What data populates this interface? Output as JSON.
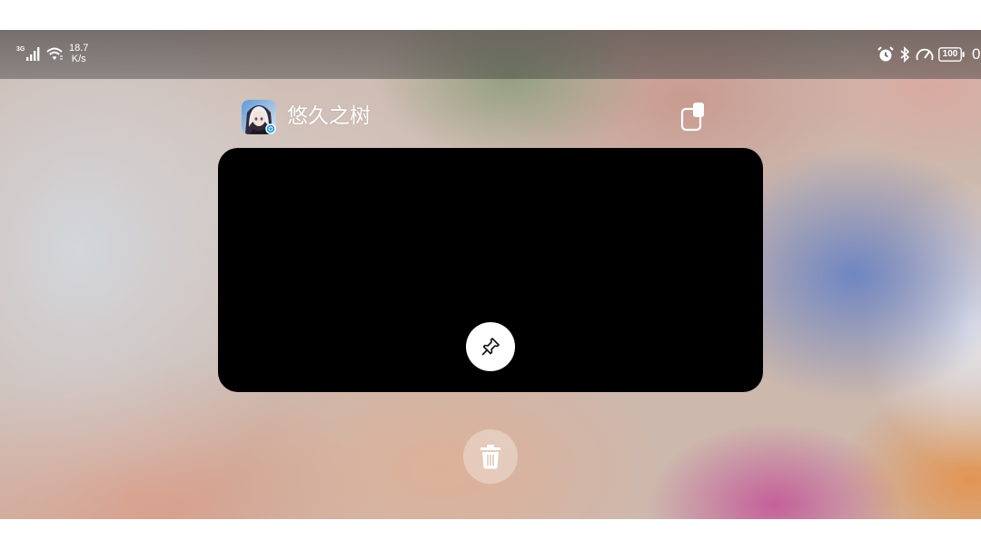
{
  "status_bar": {
    "network_type": "3G",
    "speed_value": "18.7",
    "speed_unit": "K/s",
    "battery_level": "100",
    "clock_fragment": "0",
    "icons": [
      "signal-icon",
      "wifi-icon",
      "alarm-icon",
      "bluetooth-icon",
      "gauge-icon",
      "battery-icon"
    ]
  },
  "recent_app": {
    "app_name": "悠久之树",
    "app_icon": "app-icon",
    "split_screen_icon": "split-screen-icon"
  },
  "actions": {
    "pin_icon": "pin-icon",
    "trash_icon": "trash-icon"
  },
  "colors": {
    "card": "#000000",
    "pin_button": "#ffffff",
    "trash_button": "rgba(255,255,255,0.32)",
    "status_text": "#ffffff"
  }
}
